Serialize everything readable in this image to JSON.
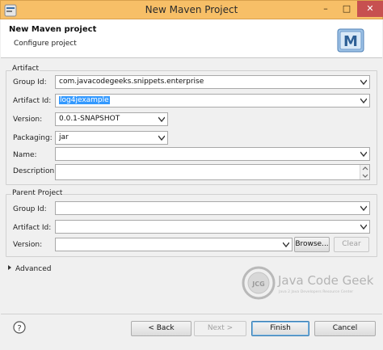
{
  "window": {
    "title": "New Maven Project",
    "minimize": "–",
    "maximize": "□",
    "close": "✕"
  },
  "header": {
    "title": "New Maven project",
    "subtitle": "Configure project",
    "logo_letter": "M"
  },
  "artifact": {
    "legend": "Artifact",
    "group_id": {
      "label": "Group Id:",
      "value": "com.javacodegeeks.snippets.enterprise"
    },
    "artifact_id": {
      "label": "Artifact Id:",
      "value": "log4jexample"
    },
    "version": {
      "label": "Version:",
      "value": "0.0.1-SNAPSHOT"
    },
    "packaging": {
      "label": "Packaging:",
      "value": "jar"
    },
    "name": {
      "label": "Name:",
      "value": ""
    },
    "description": {
      "label": "Description:",
      "value": ""
    }
  },
  "parent": {
    "legend": "Parent Project",
    "group_id": {
      "label": "Group Id:",
      "value": ""
    },
    "artifact_id": {
      "label": "Artifact Id:",
      "value": ""
    },
    "version": {
      "label": "Version:",
      "value": ""
    },
    "browse": "Browse...",
    "clear": "Clear"
  },
  "advanced": {
    "label": "Advanced"
  },
  "brand": {
    "name": "Java Code Geeks",
    "tagline": "Java 2 Java Developers Resource Center",
    "mark": "JCG"
  },
  "footer": {
    "back": "< Back",
    "next": "Next >",
    "finish": "Finish",
    "cancel": "Cancel"
  }
}
